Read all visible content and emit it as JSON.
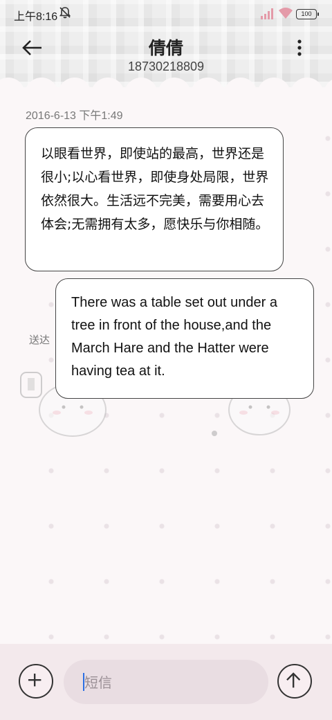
{
  "status_bar": {
    "time": "上午8:16",
    "battery": "100"
  },
  "header": {
    "contact_name": "倩倩",
    "contact_number": "18730218809"
  },
  "thread": {
    "timestamp": "2016-6-13 下午1:49",
    "messages": [
      {
        "direction": "incoming",
        "text": "以眼看世界，即使站的最高，世界还是很小;以心看世界，即使身处局限，世界依然很大。生活远不完美，需要用心去体会;无需拥有太多，愿快乐与你相随。"
      },
      {
        "direction": "outgoing",
        "text": "There was a table set out under a tree in front of the house,and the March Hare and the Hatter were having tea at it."
      }
    ],
    "sent_status": "送达"
  },
  "composer": {
    "placeholder": "短信"
  },
  "icons": {
    "back": "arrow-left-icon",
    "menu": "more-vertical-icon",
    "add": "plus-icon",
    "send": "arrow-up-icon"
  }
}
